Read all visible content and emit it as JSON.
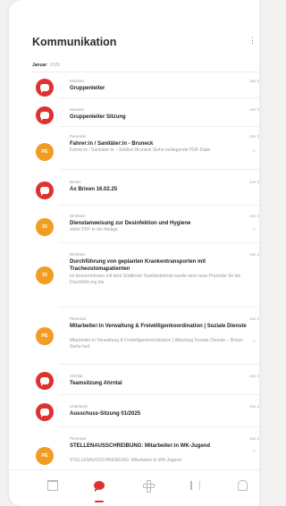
{
  "header": {
    "title": "Kommunikation",
    "month": "Januar",
    "year": "2025"
  },
  "colors": {
    "red": "#e03131",
    "orange": "#f39c23"
  },
  "messages": [
    {
      "category": "Klassen",
      "date": "Jan 2",
      "subject": "Gruppenleiter",
      "preview": "",
      "avatar": "chat-icon",
      "avatar_color": "red"
    },
    {
      "category": "Klassen",
      "date": "Jan 2",
      "subject": "Gruppenleiter Sitzung",
      "preview": "",
      "avatar": "chat-icon",
      "avatar_color": "red"
    },
    {
      "category": "Personal",
      "date": "Jan 2",
      "subject": "Fahrer:in / Sanitäter:in - Bruneck",
      "preview": "Fahrer:in / Sanitäter:in – Sektion Bruneck Siehe beiliegende PDF-Datei",
      "avatar": "PE",
      "avatar_color": "orange"
    },
    {
      "category": "Brixen",
      "date": "Jan 2",
      "subject": "Ax Brixen 16.02.25",
      "preview": "",
      "avatar": "chat-icon",
      "avatar_color": "red"
    },
    {
      "category": "Direktion",
      "date": "Jan 2",
      "subject": "Dienstanweisung zur Desinfektion und Hygiene",
      "preview": "siehe PDF in der Anlage",
      "avatar": "DI",
      "avatar_color": "orange"
    },
    {
      "category": "Direktion",
      "date": "Jan 2",
      "subject": "Durchführung von geplanten Krankentransporten mit Tracheostomapatienten",
      "preview": "Im Einvernehmen mit dem Südtiroler Sanitätsbetrieb wurde eine neue Prozedur für die Durchführung der",
      "avatar": "DI",
      "avatar_color": "orange"
    },
    {
      "category": "Personal",
      "date": "Jan 2",
      "subject": "Mitarbeiter:in Verwaltung & Freiwilligenkoordination | Soziale Dienste",
      "preview": "Mitarbeiter:in Verwaltung & Freiwilligenkoordination | Abteilung Soziale Dienste – Brixen Siehe beil",
      "avatar": "PE",
      "avatar_color": "orange"
    },
    {
      "category": "Ahrntal",
      "date": "Jan 2",
      "subject": "Teamsitzung Ahrntal",
      "preview": "",
      "avatar": "chat-icon",
      "avatar_color": "red"
    },
    {
      "category": "Unterland",
      "date": "Jan 2",
      "subject": "Ausschuss-Sitzung 01/2025",
      "preview": "",
      "avatar": "chat-icon",
      "avatar_color": "red"
    },
    {
      "category": "Personal",
      "date": "Jan 2",
      "subject": "STELLENAUSSCHREIBUNG: Mitarbeiter:in WK-Jugend",
      "preview": "STELLENAUSSCHREIBUNG: Mitarbeiter:in WK-Jugend",
      "avatar": "PE",
      "avatar_color": "orange"
    }
  ],
  "tabbar": {
    "tabs": [
      "calendar-icon",
      "messages-icon",
      "cross-icon",
      "documents-icon",
      "notifications-icon"
    ],
    "active": "messages-icon"
  }
}
